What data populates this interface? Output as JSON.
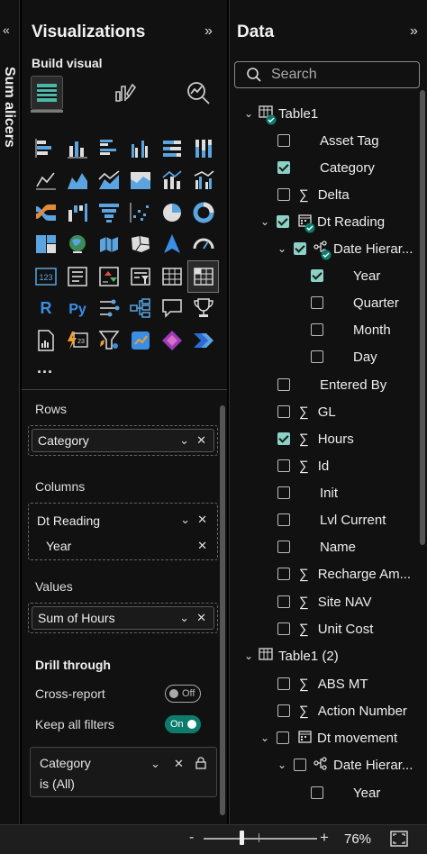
{
  "left_strip": {
    "collapsed_label": "Sum alicers",
    "expand_icon": "chevron-double-left-icon"
  },
  "viz": {
    "title": "Visualizations",
    "build_label": "Build visual",
    "more": "...",
    "wells": {
      "rows_label": "Rows",
      "rows_field": "Category",
      "columns_label": "Columns",
      "columns_field": "Dt Reading",
      "columns_subfield": "Year",
      "values_label": "Values",
      "values_field": "Sum of Hours"
    },
    "drill": {
      "title": "Drill through",
      "cross_report_label": "Cross-report",
      "cross_report_state": "Off",
      "keep_filters_label": "Keep all filters",
      "keep_filters_state": "On",
      "filter_line1": "Category",
      "filter_line2": "is (All)"
    }
  },
  "data": {
    "title": "Data",
    "search_placeholder": "Search",
    "rows": [
      {
        "label": "Table1"
      },
      {
        "label": "Asset Tag"
      },
      {
        "label": "Category"
      },
      {
        "label": "Delta"
      },
      {
        "label": "Dt Reading"
      },
      {
        "label": "Date Hierar..."
      },
      {
        "label": "Year"
      },
      {
        "label": "Quarter"
      },
      {
        "label": "Month"
      },
      {
        "label": "Day"
      },
      {
        "label": "Entered By"
      },
      {
        "label": "GL"
      },
      {
        "label": "Hours"
      },
      {
        "label": "Id"
      },
      {
        "label": "Init"
      },
      {
        "label": "Lvl Current"
      },
      {
        "label": "Name"
      },
      {
        "label": "Recharge Am..."
      },
      {
        "label": "Site NAV"
      },
      {
        "label": "Unit Cost"
      },
      {
        "label": "Table1 (2)"
      },
      {
        "label": "ABS MT"
      },
      {
        "label": "Action Number"
      },
      {
        "label": "Dt movement"
      },
      {
        "label": "Date Hierar..."
      },
      {
        "label": "Year"
      }
    ]
  },
  "status": {
    "minus": "-",
    "plus": "+",
    "zoom": "76%"
  },
  "colors": {
    "accent": "#8bd1c5",
    "toggle_on": "#0c7c6c"
  }
}
